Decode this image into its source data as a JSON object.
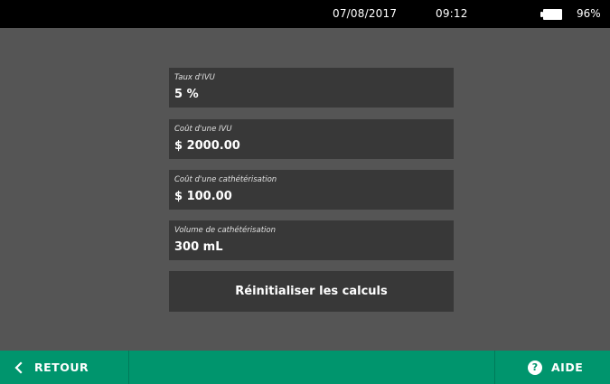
{
  "status_bar": {
    "date": "07/08/2017",
    "time": "09:12",
    "battery_percent": "96%",
    "battery_icon": "battery-icon"
  },
  "fields": [
    {
      "label": "Taux d'IVU",
      "value": "5 %"
    },
    {
      "label": "Coût d'une IVU",
      "value": "$ 2000.00"
    },
    {
      "label": "Coût d'une cathétérisation",
      "value": "$ 100.00"
    },
    {
      "label": "Volume de cathétérisation",
      "value": "300 mL"
    }
  ],
  "reset_button": {
    "label": "Réinitialiser les calculs"
  },
  "bottom_bar": {
    "back_label": "RETOUR",
    "back_icon": "chevron-left-icon",
    "help_label": "AIDE",
    "help_icon": "help-circle-icon",
    "color": "#00956d"
  },
  "colors": {
    "background": "#555555",
    "panel": "#383838",
    "status_bar": "#000000"
  }
}
